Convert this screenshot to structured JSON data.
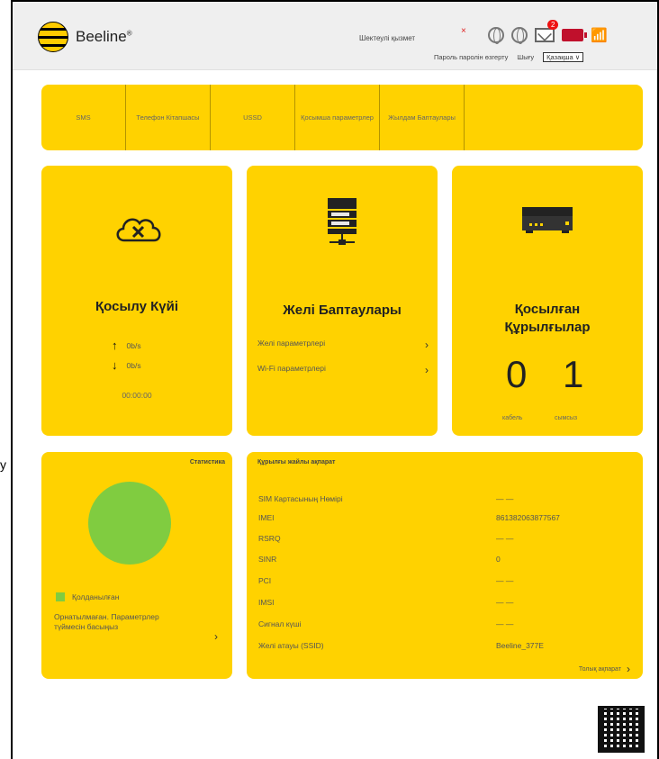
{
  "brand": {
    "name": "Beeline",
    "mark": "®",
    "colors": {
      "yellow": "#ffd200",
      "pie_green": "#80cc40",
      "battery_red": "#c0102c",
      "badge_red": "#e11111"
    }
  },
  "header": {
    "service_link": "Шектеулі қызмет",
    "x_mark": "×",
    "mail_badge": "2",
    "change_password": "Пароль паролін өзгерту",
    "logout": "Шығу",
    "language": "Қазақша ∨",
    "icons": [
      "globe-icon",
      "globe-icon",
      "mail-icon",
      "battery-icon",
      "wifi-icon"
    ]
  },
  "tabs": [
    {
      "label": "SMS"
    },
    {
      "label": "Телефон Кітапшасы"
    },
    {
      "label": "USSD"
    },
    {
      "label": "Қосымша параметрлер"
    },
    {
      "label": "Жылдам Баптаулары"
    }
  ],
  "connection": {
    "title": "Қосылу Күйі",
    "upload": "0b/s",
    "download": "0b/s",
    "timer": "00:00:00"
  },
  "network": {
    "title": "Желі Баптаулары",
    "items": [
      {
        "label": "Желі параметрлері"
      },
      {
        "label": "Wi-Fi параметрлері"
      }
    ]
  },
  "devices": {
    "title_line1": "Қосылған",
    "title_line2": "Құрылғылар",
    "cable_count": "0",
    "wireless_count": "1",
    "cable_label": "кабель",
    "wireless_label": "сымсыз"
  },
  "stats": {
    "title": "Статистика",
    "legend": "Қолданылған",
    "note": "Орнатылмаған. Параметрлер түймесін басыңыз"
  },
  "info": {
    "title": "Құрылғы жайлы ақпарат",
    "rows": [
      {
        "key": "SIM Картасының Нөмірі",
        "value": "— —"
      },
      {
        "key": "IMEI",
        "value": "861382063877567"
      },
      {
        "key": "RSRQ",
        "value": "— —"
      },
      {
        "key": "SINR",
        "value": "0"
      },
      {
        "key": "PCI",
        "value": "— —"
      },
      {
        "key": "IMSI",
        "value": "— —"
      },
      {
        "key": "Сигнал күші",
        "value": "— —"
      },
      {
        "key": "Желі атауы (SSID)",
        "value": "Beeline_377E"
      }
    ],
    "more": "Толық ақпарат"
  },
  "stray_mark": "y"
}
